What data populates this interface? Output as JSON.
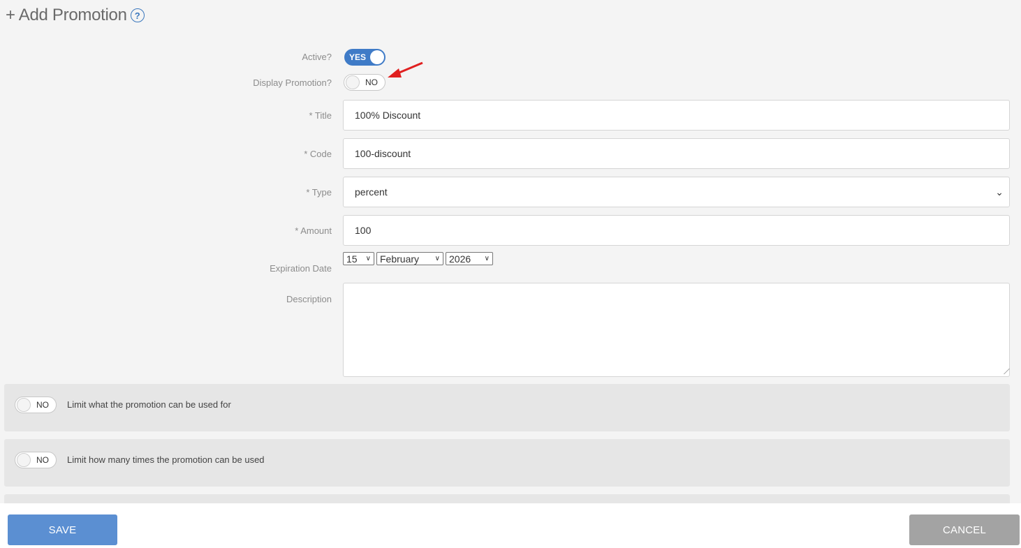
{
  "header": {
    "title": "+ Add Promotion",
    "help_icon": "?"
  },
  "form": {
    "active": {
      "label": "Active?",
      "state": "YES"
    },
    "display_promotion": {
      "label": "Display Promotion?",
      "state": "NO"
    },
    "title": {
      "label": "* Title",
      "value": "100% Discount"
    },
    "code": {
      "label": "* Code",
      "value": "100-discount"
    },
    "type": {
      "label": "* Type",
      "value": "percent"
    },
    "amount": {
      "label": "* Amount",
      "value": "100"
    },
    "expiration": {
      "label": "Expiration Date",
      "day": "15",
      "month": "February",
      "year": "2026"
    },
    "description": {
      "label": "Description",
      "value": ""
    }
  },
  "panels": {
    "limit_use": {
      "state": "NO",
      "label": "Limit what the promotion can be used for"
    },
    "limit_times": {
      "state": "NO",
      "label": "Limit how many times the promotion can be used"
    }
  },
  "footer": {
    "save_label": "SAVE",
    "cancel_label": "CANCEL"
  },
  "colors": {
    "accent": "#3f7bc7",
    "save": "#5b8fd2",
    "cancel": "#a3a3a3",
    "annotation_arrow": "#e02020"
  }
}
